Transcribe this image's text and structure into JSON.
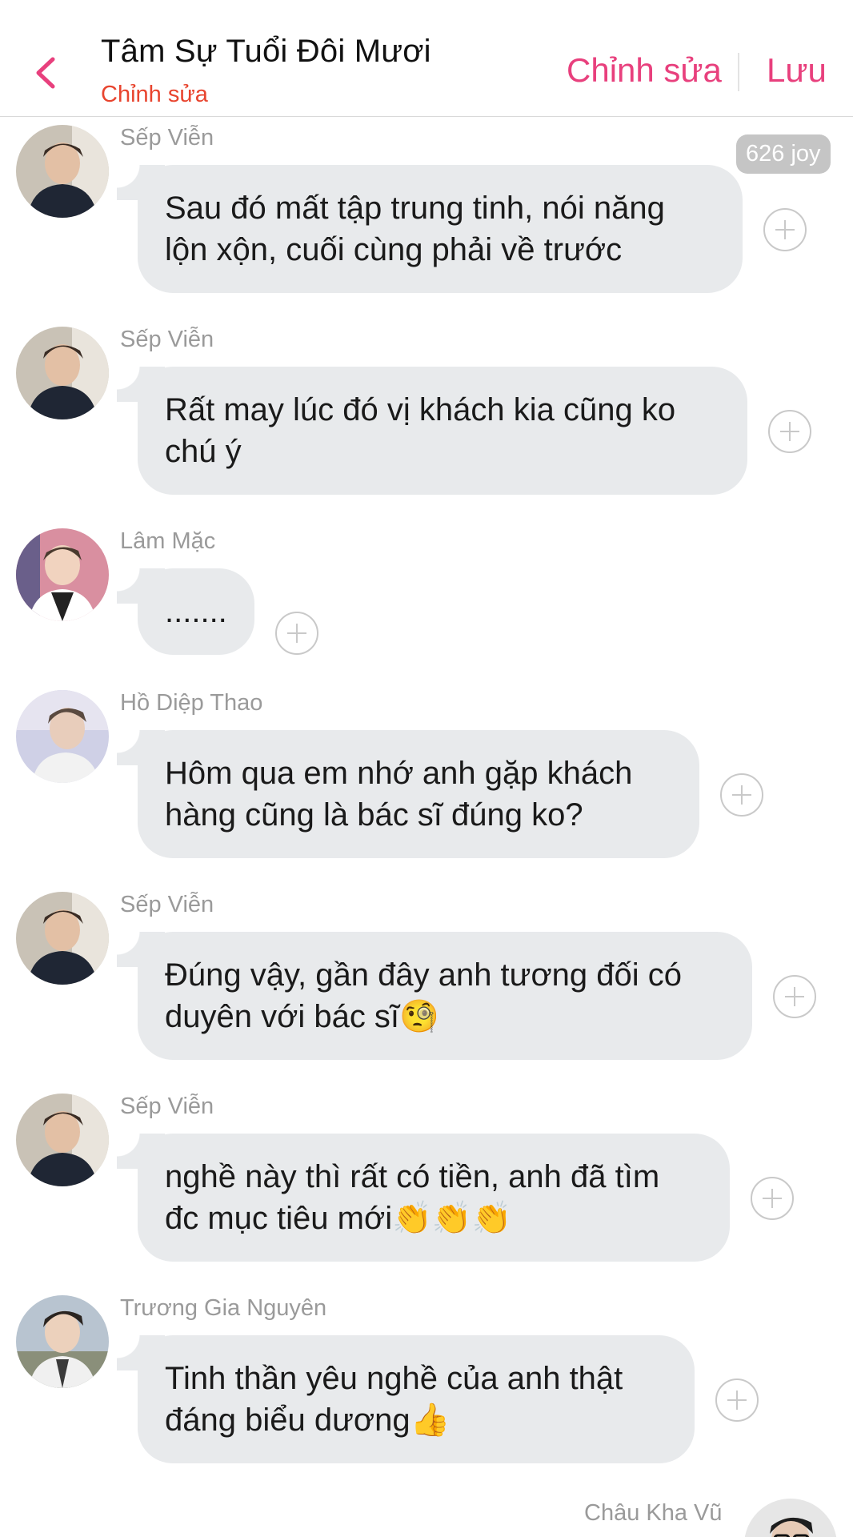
{
  "header": {
    "title": "Tâm Sự Tuổi Đôi Mươi",
    "subtitle": "Chỉnh sửa",
    "edit_label": "Chỉnh sửa",
    "save_label": "Lưu",
    "accent_color": "#e8407d",
    "subtitle_color": "#e8442e"
  },
  "badge": {
    "text": "626 joy"
  },
  "messages": [
    {
      "sender": "Sếp Viễn",
      "text": "Sau đó mất tập trung tinh, nói năng\nlộn xộn, cuối cùng phải về trước",
      "avatar": "avatar-sep-vien"
    },
    {
      "sender": "Sếp Viễn",
      "text": "Rất may lúc đó vị khách kia cũng ko\nchú ý",
      "avatar": "avatar-sep-vien"
    },
    {
      "sender": "Lâm Mặc",
      "text": ".......",
      "avatar": "avatar-lam-mac"
    },
    {
      "sender": "Hồ Diệp Thao",
      "text": "Hôm qua em nhớ anh gặp khách\nhàng cũng là bác sĩ đúng ko?",
      "avatar": "avatar-ho-diep-thao"
    },
    {
      "sender": "Sếp Viễn",
      "text": "Đúng vậy, gần đây anh tương đối có\nduyên với bác sĩ🧐",
      "avatar": "avatar-sep-vien"
    },
    {
      "sender": "Sếp Viễn",
      "text": "nghề này thì rất có tiền, anh đã tìm\nđc mục tiêu mới👏👏👏",
      "avatar": "avatar-sep-vien"
    },
    {
      "sender": "Trương Gia Nguyên",
      "text": "Tinh thần yêu nghề của anh thật\nđáng biểu dương👍",
      "avatar": "avatar-truong-gia-nguyen"
    }
  ],
  "last_message": {
    "sender": "Châu Kha Vũ",
    "avatar": "avatar-chau-kha-vu"
  }
}
